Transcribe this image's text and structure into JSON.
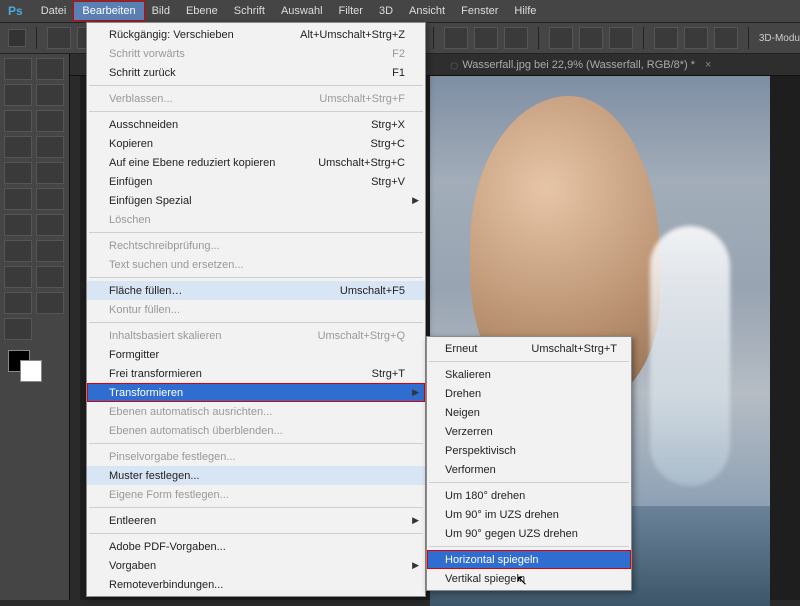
{
  "app": {
    "logo": "Ps"
  },
  "menubar": [
    {
      "label": "Datei"
    },
    {
      "label": "Bearbeiten",
      "active": true
    },
    {
      "label": "Bild"
    },
    {
      "label": "Ebene"
    },
    {
      "label": "Schrift"
    },
    {
      "label": "Auswahl"
    },
    {
      "label": "Filter"
    },
    {
      "label": "3D"
    },
    {
      "label": "Ansicht"
    },
    {
      "label": "Fenster"
    },
    {
      "label": "Hilfe"
    }
  ],
  "options_bar": {
    "mode_label": "3D-Modu"
  },
  "doc_tab": {
    "title": "Wasserfall.jpg bei 22,9% (Wasserfall, RGB/8*) *"
  },
  "edit_menu": [
    {
      "label": "Rückgängig: Verschieben",
      "shortcut": "Alt+Umschalt+Strg+Z"
    },
    {
      "label": "Schritt vorwärts",
      "shortcut": "F2",
      "disabled": true
    },
    {
      "label": "Schritt zurück",
      "shortcut": "F1"
    },
    {
      "sep": true
    },
    {
      "label": "Verblassen...",
      "shortcut": "Umschalt+Strg+F",
      "disabled": true
    },
    {
      "sep": true
    },
    {
      "label": "Ausschneiden",
      "shortcut": "Strg+X"
    },
    {
      "label": "Kopieren",
      "shortcut": "Strg+C"
    },
    {
      "label": "Auf eine Ebene reduziert kopieren",
      "shortcut": "Umschalt+Strg+C"
    },
    {
      "label": "Einfügen",
      "shortcut": "Strg+V"
    },
    {
      "label": "Einfügen Spezial",
      "submenu": true
    },
    {
      "label": "Löschen",
      "disabled": true
    },
    {
      "sep": true
    },
    {
      "label": "Rechtschreibprüfung...",
      "disabled": true
    },
    {
      "label": "Text suchen und ersetzen...",
      "disabled": true
    },
    {
      "sep": true
    },
    {
      "label": "Fläche füllen…",
      "shortcut": "Umschalt+F5",
      "hl": "light"
    },
    {
      "label": "Kontur füllen...",
      "disabled": true
    },
    {
      "sep": true
    },
    {
      "label": "Inhaltsbasiert skalieren",
      "shortcut": "Umschalt+Strg+Q",
      "disabled": true
    },
    {
      "label": "Formgitter"
    },
    {
      "label": "Frei transformieren",
      "shortcut": "Strg+T"
    },
    {
      "label": "Transformieren",
      "submenu": true,
      "hl": "blue",
      "boxed": true
    },
    {
      "label": "Ebenen automatisch ausrichten...",
      "disabled": true
    },
    {
      "label": "Ebenen automatisch überblenden...",
      "disabled": true
    },
    {
      "sep": true
    },
    {
      "label": "Pinselvorgabe festlegen...",
      "disabled": true
    },
    {
      "label": "Muster festlegen...",
      "hl": "light"
    },
    {
      "label": "Eigene Form festlegen...",
      "disabled": true
    },
    {
      "sep": true
    },
    {
      "label": "Entleeren",
      "submenu": true
    },
    {
      "sep": true
    },
    {
      "label": "Adobe PDF-Vorgaben..."
    },
    {
      "label": "Vorgaben",
      "submenu": true
    },
    {
      "label": "Remoteverbindungen..."
    }
  ],
  "transform_submenu": [
    {
      "label": "Erneut",
      "shortcut": "Umschalt+Strg+T"
    },
    {
      "sep": true
    },
    {
      "label": "Skalieren"
    },
    {
      "label": "Drehen"
    },
    {
      "label": "Neigen"
    },
    {
      "label": "Verzerren"
    },
    {
      "label": "Perspektivisch"
    },
    {
      "label": "Verformen"
    },
    {
      "sep": true
    },
    {
      "label": "Um 180° drehen"
    },
    {
      "label": "Um 90° im UZS drehen"
    },
    {
      "label": "Um 90° gegen UZS drehen"
    },
    {
      "sep": true
    },
    {
      "label": "Horizontal spiegeln",
      "hl": "blue",
      "boxed": true
    },
    {
      "label": "Vertikal spiegeln"
    }
  ]
}
